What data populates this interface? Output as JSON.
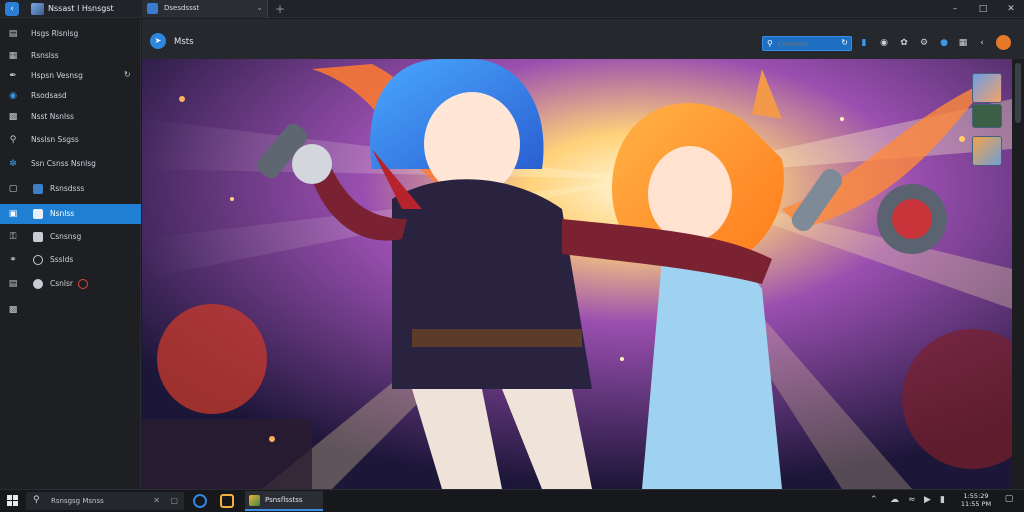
{
  "titlebar": {
    "app_title": "Nssast l Hsnsgst",
    "tab_label": "Dsesdssst",
    "icons": [
      "back-icon",
      "app-logo-icon",
      "tab-page-icon",
      "chevron-down-icon",
      "new-tab-icon",
      "minimize-icon",
      "maximize-icon",
      "close-icon"
    ]
  },
  "sidebar": {
    "items": [
      {
        "label": "Hsgs Rlsnlsg",
        "icon": "screen-icon"
      },
      {
        "label": "Rsnslss",
        "icon": "folder-icon"
      },
      {
        "label": "Hspsn Vesnsg",
        "icon": "brush-icon"
      },
      {
        "label": "Rsodsasd",
        "icon": "globe-icon"
      },
      {
        "label": "Nsst Nsnlss",
        "icon": "chat-icon"
      },
      {
        "label": "Nsslsn Ssgss",
        "icon": "search-icon"
      },
      {
        "label": "Ssn Csnss Nsnlsg",
        "icon": "swirl-icon"
      },
      {
        "label": "Rsnsdsss",
        "icon": "document-icon"
      },
      {
        "label": "Nsnlss",
        "icon": "gallery-icon"
      },
      {
        "label": "Csnsnsg",
        "icon": "key-icon"
      },
      {
        "label": "Ssslds",
        "icon": "link-icon"
      },
      {
        "label": "Csnlsr",
        "icon": "bag-icon"
      },
      {
        "label": "",
        "icon": "save-icon"
      }
    ],
    "active_index": 8
  },
  "main": {
    "title": "Msts",
    "search_placeholder": "Csnlsnsst",
    "toolbar_icons": [
      "search-icon",
      "settings-icon",
      "chat-bubble-icon",
      "badge-icon",
      "gear-icon",
      "grid-icon",
      "unread-icon",
      "profile-icon"
    ]
  },
  "canvas": {
    "description_icon": "artwork-image",
    "thumbnails": [
      "thumbnail-blue-hair-icon",
      "thumbnail-green-icon",
      "thumbnail-orange-hair-icon"
    ]
  },
  "taskbar": {
    "search_text": "Rsnsgsg Msnss",
    "active_app_label": "Psnsflsstss",
    "clock_time": "1:55:29",
    "clock_date": "11:55 PM",
    "tray_icons": [
      "chevron-up-icon",
      "cloud-icon",
      "wifi-icon",
      "volume-icon",
      "battery-icon"
    ]
  },
  "colors": {
    "accent": "#1f7fd3",
    "sidebar_bg": "#1d1f23",
    "toolbar_bg": "#25282d",
    "taskbar_bg": "#16181b",
    "orange_accent": "#e8792a"
  }
}
